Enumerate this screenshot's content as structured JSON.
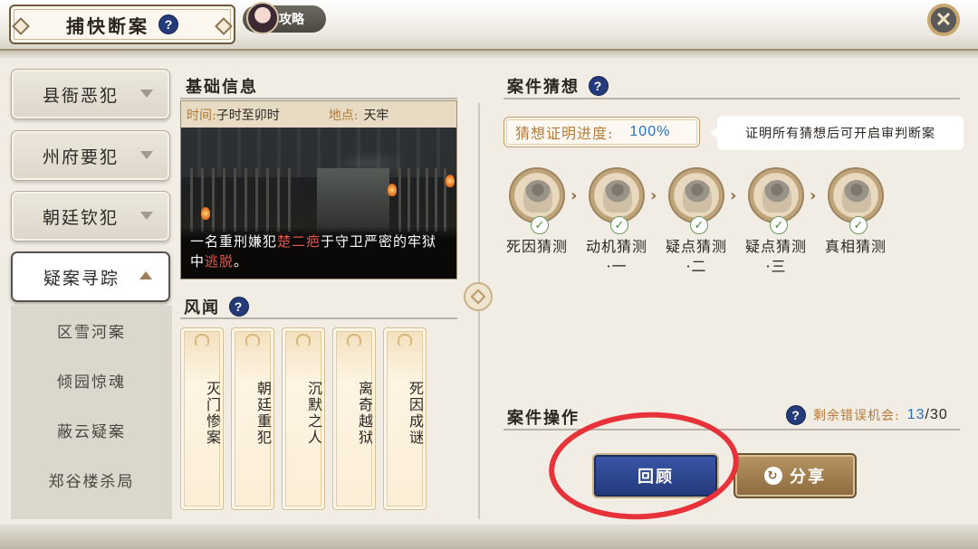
{
  "header": {
    "title": "捕快断案",
    "help_icon": "?",
    "strategy_label": "攻略",
    "close_icon": "✕"
  },
  "sidebar": {
    "categories": [
      {
        "label": "县衙恶犯"
      },
      {
        "label": "州府要犯"
      },
      {
        "label": "朝廷钦犯"
      },
      {
        "label": "疑案寻踪"
      }
    ],
    "sub_items": [
      {
        "label": "区雪河案"
      },
      {
        "label": "倾园惊魂"
      },
      {
        "label": "蔽云疑案"
      },
      {
        "label": "郑谷楼杀局"
      }
    ]
  },
  "basic_info": {
    "title": "基础信息",
    "time_label": "时间:",
    "time_value": "子时至卯时",
    "place_label": "地点:",
    "place_value": "天牢",
    "caption_1": "一名重刑嫌犯",
    "caption_name": "楚二疤",
    "caption_2": "于守卫严密的牢狱中",
    "caption_escape": "逃脱",
    "caption_end": "。"
  },
  "rumors": {
    "title": "风闻",
    "items": [
      "灭门惨案",
      "朝廷重犯",
      "沉默之人",
      "离奇越狱",
      "死因成谜"
    ]
  },
  "guess": {
    "title": "案件猜想",
    "progress_label": "猜想证明进度:",
    "progress_value": "100%",
    "progress_fraction": 1.0,
    "hint": "证明所有猜想后可开启审判断案",
    "steps": [
      {
        "label1": "死因猜测",
        "label2": ""
      },
      {
        "label1": "动机猜测",
        "label2": "·一"
      },
      {
        "label1": "疑点猜测",
        "label2": "·二"
      },
      {
        "label1": "疑点猜测",
        "label2": "·三"
      },
      {
        "label1": "真相猜测",
        "label2": ""
      }
    ]
  },
  "operations": {
    "title": "案件操作",
    "remaining_label": "剩余错误机会:",
    "remaining_current": "13",
    "remaining_sep": "/",
    "remaining_total": "30",
    "review_button": "回顾",
    "share_button": "分享"
  },
  "colors": {
    "accent_blue": "#2d6fb8",
    "accent_gold": "#b67b3a",
    "annotation_red": "#e8323a"
  }
}
